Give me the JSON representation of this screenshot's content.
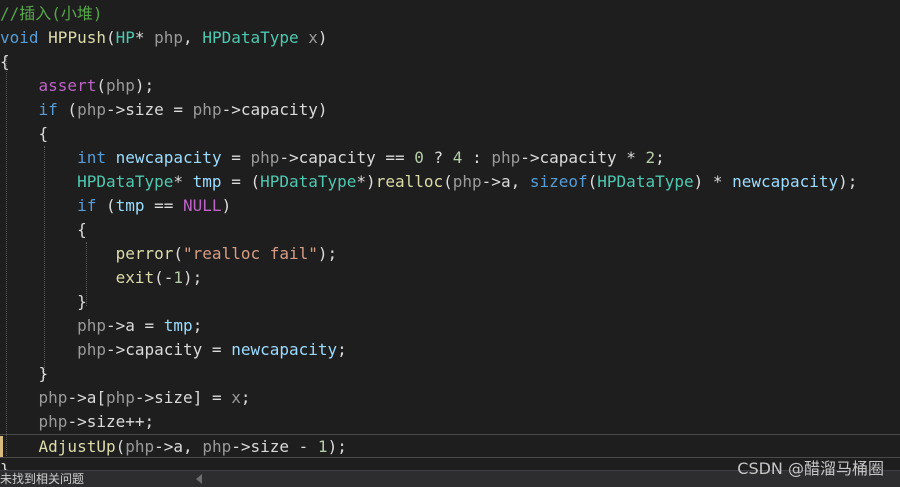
{
  "colors": {
    "background": "#1e1e1e",
    "comment": "#57a64a",
    "keyword": "#569cd6",
    "function": "#dcdcaa",
    "type": "#4ec9b0",
    "parameter": "#9a9a9a",
    "local": "#9cdcfe",
    "string": "#d69d85",
    "number": "#b5cea8",
    "macro": "#bd63c5",
    "member": "#dadada",
    "default": "#dcdcdc"
  },
  "code": {
    "lines": [
      [
        {
          "t": "//插入(小堆)",
          "k": "comment"
        }
      ],
      [
        {
          "t": "void",
          "k": "keyword"
        },
        {
          "t": " "
        },
        {
          "t": "HPPush",
          "k": "function"
        },
        {
          "t": "("
        },
        {
          "t": "HP",
          "k": "type"
        },
        {
          "t": "* "
        },
        {
          "t": "php",
          "k": "parameter"
        },
        {
          "t": ", "
        },
        {
          "t": "HPDataType",
          "k": "type"
        },
        {
          "t": " "
        },
        {
          "t": "x",
          "k": "parameter"
        },
        {
          "t": ")"
        }
      ],
      [
        {
          "t": "{"
        }
      ],
      [
        {
          "t": "    "
        },
        {
          "t": "assert",
          "k": "macro"
        },
        {
          "t": "("
        },
        {
          "t": "php",
          "k": "parameter"
        },
        {
          "t": ");"
        }
      ],
      [
        {
          "t": "    "
        },
        {
          "t": "if",
          "k": "keyword"
        },
        {
          "t": " ("
        },
        {
          "t": "php",
          "k": "parameter"
        },
        {
          "t": "->"
        },
        {
          "t": "size",
          "k": "member"
        },
        {
          "t": " = "
        },
        {
          "t": "php",
          "k": "parameter"
        },
        {
          "t": "->"
        },
        {
          "t": "capacity",
          "k": "member"
        },
        {
          "t": ")"
        }
      ],
      [
        {
          "t": "    {"
        }
      ],
      [
        {
          "t": "        "
        },
        {
          "t": "int",
          "k": "keyword"
        },
        {
          "t": " "
        },
        {
          "t": "newcapacity",
          "k": "local"
        },
        {
          "t": " = "
        },
        {
          "t": "php",
          "k": "parameter"
        },
        {
          "t": "->"
        },
        {
          "t": "capacity",
          "k": "member"
        },
        {
          "t": " == "
        },
        {
          "t": "0",
          "k": "number"
        },
        {
          "t": " ? "
        },
        {
          "t": "4",
          "k": "number"
        },
        {
          "t": " : "
        },
        {
          "t": "php",
          "k": "parameter"
        },
        {
          "t": "->"
        },
        {
          "t": "capacity",
          "k": "member"
        },
        {
          "t": " * "
        },
        {
          "t": "2",
          "k": "number"
        },
        {
          "t": ";"
        }
      ],
      [
        {
          "t": "        "
        },
        {
          "t": "HPDataType",
          "k": "type"
        },
        {
          "t": "* "
        },
        {
          "t": "tmp",
          "k": "local"
        },
        {
          "t": " = ("
        },
        {
          "t": "HPDataType",
          "k": "type"
        },
        {
          "t": "*)"
        },
        {
          "t": "realloc",
          "k": "function"
        },
        {
          "t": "("
        },
        {
          "t": "php",
          "k": "parameter"
        },
        {
          "t": "->"
        },
        {
          "t": "a",
          "k": "member"
        },
        {
          "t": ", "
        },
        {
          "t": "sizeof",
          "k": "keyword"
        },
        {
          "t": "("
        },
        {
          "t": "HPDataType",
          "k": "type"
        },
        {
          "t": ") * "
        },
        {
          "t": "newcapacity",
          "k": "local"
        },
        {
          "t": ");"
        }
      ],
      [
        {
          "t": "        "
        },
        {
          "t": "if",
          "k": "keyword"
        },
        {
          "t": " ("
        },
        {
          "t": "tmp",
          "k": "local"
        },
        {
          "t": " == "
        },
        {
          "t": "NULL",
          "k": "macro"
        },
        {
          "t": ")"
        }
      ],
      [
        {
          "t": "        {"
        }
      ],
      [
        {
          "t": "            "
        },
        {
          "t": "perror",
          "k": "function"
        },
        {
          "t": "("
        },
        {
          "t": "\"realloc fail\"",
          "k": "string"
        },
        {
          "t": ");"
        }
      ],
      [
        {
          "t": "            "
        },
        {
          "t": "exit",
          "k": "function"
        },
        {
          "t": "(-"
        },
        {
          "t": "1",
          "k": "number"
        },
        {
          "t": ");"
        }
      ],
      [
        {
          "t": "        }"
        }
      ],
      [
        {
          "t": "        "
        },
        {
          "t": "php",
          "k": "parameter"
        },
        {
          "t": "->"
        },
        {
          "t": "a",
          "k": "member"
        },
        {
          "t": " = "
        },
        {
          "t": "tmp",
          "k": "local"
        },
        {
          "t": ";"
        }
      ],
      [
        {
          "t": "        "
        },
        {
          "t": "php",
          "k": "parameter"
        },
        {
          "t": "->"
        },
        {
          "t": "capacity",
          "k": "member"
        },
        {
          "t": " = "
        },
        {
          "t": "newcapacity",
          "k": "local"
        },
        {
          "t": ";"
        }
      ],
      [
        {
          "t": "    }"
        }
      ],
      [
        {
          "t": "    "
        },
        {
          "t": "php",
          "k": "parameter"
        },
        {
          "t": "->"
        },
        {
          "t": "a",
          "k": "member"
        },
        {
          "t": "["
        },
        {
          "t": "php",
          "k": "parameter"
        },
        {
          "t": "->"
        },
        {
          "t": "size",
          "k": "member"
        },
        {
          "t": "] = "
        },
        {
          "t": "x",
          "k": "parameter"
        },
        {
          "t": ";"
        }
      ],
      [
        {
          "t": "    "
        },
        {
          "t": "php",
          "k": "parameter"
        },
        {
          "t": "->"
        },
        {
          "t": "size",
          "k": "member"
        },
        {
          "t": "++;"
        }
      ],
      [
        {
          "t": "    "
        },
        {
          "t": "AdjustUp",
          "k": "function"
        },
        {
          "t": "("
        },
        {
          "t": "php",
          "k": "parameter"
        },
        {
          "t": "->"
        },
        {
          "t": "a",
          "k": "member"
        },
        {
          "t": ", "
        },
        {
          "t": "php",
          "k": "parameter"
        },
        {
          "t": "->"
        },
        {
          "t": "size",
          "k": "member"
        },
        {
          "t": " - "
        },
        {
          "t": "1",
          "k": "number"
        },
        {
          "t": ");"
        }
      ],
      [
        {
          "t": "}"
        }
      ]
    ]
  },
  "status": {
    "text": "未找到相关问题"
  },
  "watermark": {
    "text": "CSDN @醋溜马桶圈"
  }
}
